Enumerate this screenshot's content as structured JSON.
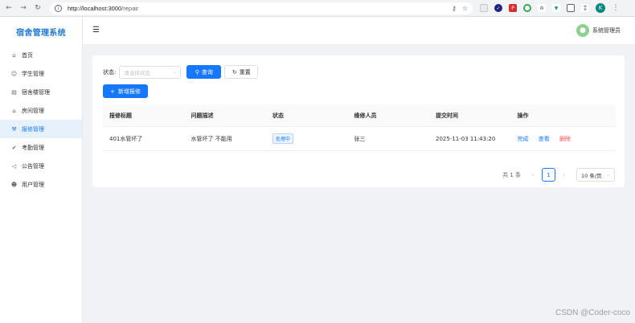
{
  "browser": {
    "url_host": "http://localhost:3000",
    "url_path": "/repair",
    "profile_initial": "K",
    "icons": [
      "back-icon",
      "forward-icon",
      "reload-icon",
      "site-info-icon",
      "password-key-icon",
      "bookmark-star-icon",
      "extensions-icon",
      "download-icon"
    ]
  },
  "sidebar": {
    "brand": "宿舍管理系统",
    "items": [
      {
        "label": "首页",
        "icon": "home-icon"
      },
      {
        "label": "学生管理",
        "icon": "user-icon"
      },
      {
        "label": "宿舍楼管理",
        "icon": "building-icon"
      },
      {
        "label": "房间管理",
        "icon": "room-icon"
      },
      {
        "label": "报修管理",
        "icon": "wrench-icon"
      },
      {
        "label": "考勤管理",
        "icon": "check-circle-icon"
      },
      {
        "label": "公告管理",
        "icon": "megaphone-icon"
      },
      {
        "label": "用户管理",
        "icon": "users-icon"
      }
    ],
    "active_index": 4
  },
  "header": {
    "user_name": "系统管理员"
  },
  "filter": {
    "label": "状态:",
    "placeholder": "请选择状态",
    "search_label": "查询",
    "reset_label": "重置"
  },
  "add_button_label": "新增报修",
  "table": {
    "columns": [
      "报修标题",
      "问题描述",
      "状态",
      "维修人员",
      "提交时间",
      "操作"
    ],
    "rows": [
      {
        "title": "401水管坏了",
        "description": "水管坏了 不能用",
        "status": "处理中",
        "repairer": "张三",
        "submitted": "2025-11-03 11:43:20",
        "actions": [
          "完成",
          "查看",
          "删除"
        ]
      }
    ]
  },
  "pagination": {
    "total_text": "共 1 条",
    "current_page": "1",
    "page_size": "10 条/页"
  },
  "watermark": "CSDN @Coder-coco",
  "colors": {
    "primary": "#1677ff",
    "danger": "#ff4d4f",
    "brand": "#1f78d1",
    "background": "#f0f2f5"
  }
}
